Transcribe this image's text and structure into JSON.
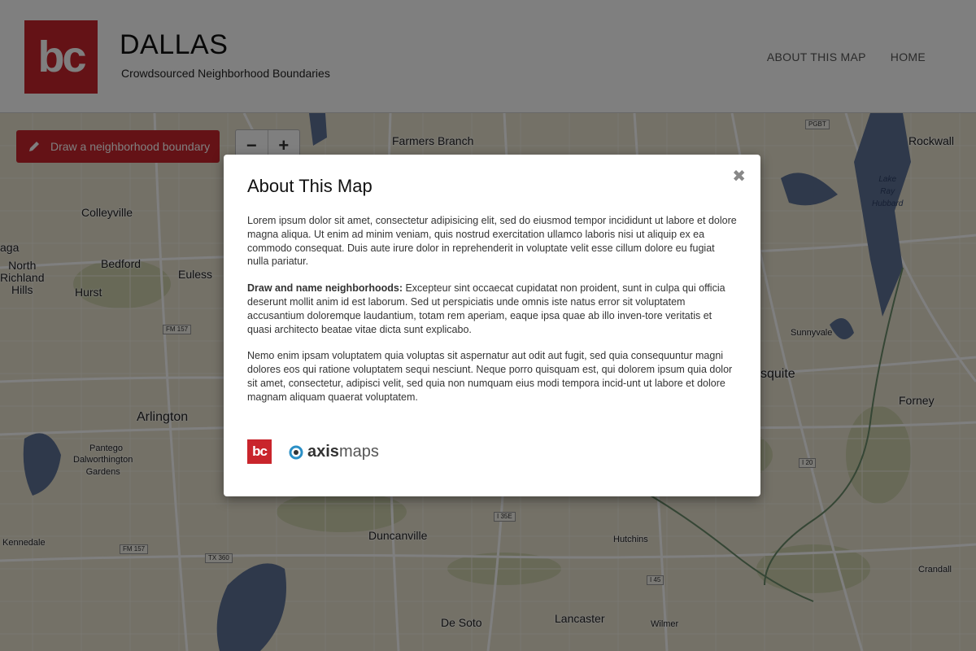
{
  "header": {
    "logo_text": "bc",
    "title": "DALLAS",
    "subtitle": "Crowdsourced Neighborhood Boundaries",
    "nav": [
      {
        "label": "ABOUT THIS MAP"
      },
      {
        "label": "HOME"
      }
    ]
  },
  "toolbar": {
    "draw_label": "Draw a neighborhood boundary",
    "zoom_out": "−",
    "zoom_in": "+"
  },
  "map": {
    "labels": {
      "farmers_branch": "Farmers\nBranch",
      "rockwall": "Rockwall",
      "colleyville": "Colleyville",
      "north_richland_hills": "North\nRichland\nHills",
      "bedford": "Bedford",
      "euless": "Euless",
      "hurst": "Hurst",
      "aga": "aga",
      "sunnyvale": "Sunnyvale",
      "mesquite": "squite",
      "forney": "Forney",
      "arlington": "Arlington",
      "pantego": "Pantego",
      "dalworthington": "Dalworthington\nGardens",
      "kennedale": "Kennedale",
      "duncanville": "Duncanville",
      "hutchins": "Hutchins",
      "crandall": "Crandall",
      "de_soto": "De Soto",
      "lancaster": "Lancaster",
      "wilmer": "Wilmer",
      "lake_ray_hubbard": "Lake\nRay\nHubbard"
    },
    "shields": {
      "pgbt": "PGBT",
      "fm157a": "FM 157",
      "fm157b": "FM 157",
      "tx360": "TX 360",
      "i35e": "I 35E",
      "i45": "I 45",
      "i20": "I 20"
    }
  },
  "modal": {
    "title": "About This Map",
    "close": "✖",
    "p1": "Lorem ipsum dolor sit amet, consectetur adipisicing elit, sed do eiusmod tempor incididunt ut labore et dolore magna aliqua. Ut enim ad minim veniam, quis nostrud exercitation ullamco laboris nisi ut aliquip ex ea commodo consequat. Duis aute irure dolor in reprehenderit in voluptate velit esse cillum dolore eu fugiat nulla pariatur.",
    "p2_bold": "Draw and name neighborhoods:",
    "p2": " Excepteur sint occaecat cupidatat non proident, sunt in culpa qui officia deserunt mollit anim id est laborum. Sed ut perspiciatis unde omnis iste natus error sit voluptatem accusantium doloremque laudantium, totam rem aperiam, eaque ipsa quae ab illo inven-tore veritatis et quasi architecto beatae vitae dicta sunt explicabo.",
    "p3": "Nemo enim ipsam voluptatem quia voluptas sit aspernatur aut odit aut fugit, sed quia consequuntur magni dolores eos qui ratione voluptatem sequi nesciunt. Neque porro quisquam est, qui dolorem ipsum quia dolor sit amet, consectetur, adipisci velit, sed quia non numquam eius modi tempora incid-unt ut labore et dolore magnam aliquam quaerat voluptatem.",
    "footer_bc": "bc",
    "footer_axis_bold": "axis",
    "footer_axis_light": "maps"
  },
  "colors": {
    "brand_red": "#c9252c",
    "water": "#5f7396",
    "land": "#e8e2cf",
    "road": "#ffffff"
  }
}
